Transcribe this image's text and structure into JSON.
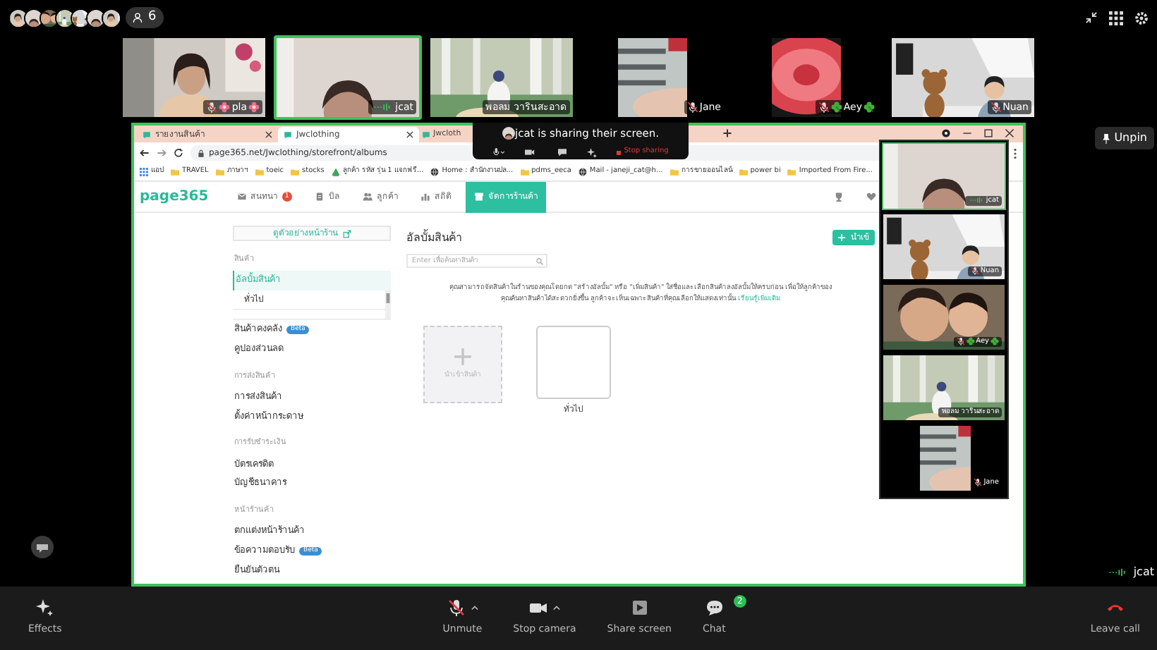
{
  "top_bar": {
    "participant_count": "6"
  },
  "filmstrip": [
    {
      "name": "pla",
      "flowers": true,
      "clovers": false,
      "muted": true,
      "speaking": false,
      "active": false,
      "portrait": false
    },
    {
      "name": "jcat",
      "flowers": false,
      "clovers": false,
      "muted": false,
      "speaking": true,
      "active": true,
      "portrait": false
    },
    {
      "name": "พอลม วารินสะอาด",
      "flowers": false,
      "clovers": false,
      "muted": false,
      "speaking": false,
      "active": false,
      "portrait": false
    },
    {
      "name": "Jane",
      "flowers": false,
      "clovers": false,
      "muted": true,
      "speaking": false,
      "active": false,
      "portrait": true
    },
    {
      "name": "Aey",
      "flowers": false,
      "clovers": true,
      "muted": true,
      "speaking": false,
      "active": false,
      "portrait": true
    },
    {
      "name": "Nuan",
      "flowers": false,
      "clovers": false,
      "muted": true,
      "speaking": false,
      "active": false,
      "portrait": false
    }
  ],
  "browser": {
    "tabs": [
      {
        "label": "รายงานสินค้า",
        "selected": false
      },
      {
        "label": "Jwclothing",
        "selected": true
      },
      {
        "label": "Jwcloth",
        "selected": false
      }
    ],
    "address": "page365.net/Jwclothing/storefront/albums",
    "bookmarks": [
      {
        "label": "แอป",
        "kind": "apps"
      },
      {
        "label": "TRAVEL",
        "kind": "folder"
      },
      {
        "label": "ภาษาฯ",
        "kind": "folder"
      },
      {
        "label": "toeic",
        "kind": "folder"
      },
      {
        "label": "stocks",
        "kind": "folder"
      },
      {
        "label": "ลูกค้า รหัส รุ่น 1 แจกฟรี...",
        "kind": "drive"
      },
      {
        "label": "Home : สำนักงานปล...",
        "kind": "globe"
      },
      {
        "label": "pdms_eeca",
        "kind": "folder"
      },
      {
        "label": "Mail - janeji_cat@h...",
        "kind": "globe"
      },
      {
        "label": "การขายออนไลน์",
        "kind": "folder"
      },
      {
        "label": "power bi",
        "kind": "folder"
      },
      {
        "label": "Imported From Fire...",
        "kind": "folder"
      }
    ]
  },
  "app": {
    "logo": "page365",
    "nav": [
      {
        "label": "สนทนา",
        "kind": "chat",
        "badge": "1",
        "selected": false
      },
      {
        "label": "บิล",
        "kind": "bill",
        "selected": false
      },
      {
        "label": "ลูกค้า",
        "kind": "customers",
        "selected": false
      },
      {
        "label": "สถิติ",
        "kind": "stats",
        "selected": false
      },
      {
        "label": "จัดการร้านค้า",
        "kind": "store",
        "selected": true
      }
    ],
    "preview_button": "ดูตัวอย่างหน้าร้าน",
    "sidebar": [
      {
        "heading": "สินค้า",
        "items": [
          {
            "label": "อัลบั้มสินค้า",
            "selected": true,
            "children": [
              {
                "label": "ทั่วไป"
              }
            ]
          },
          {
            "label": "สินค้าคงคลัง",
            "badge": "Beta",
            "selected": false
          },
          {
            "label": "คูปองส่วนลด",
            "selected": false
          }
        ]
      },
      {
        "heading": "การส่งสินค้า",
        "items": [
          {
            "label": "การส่งสินค้า",
            "selected": false
          },
          {
            "label": "ตั้งค่าหน้ากระดาษ",
            "selected": false
          }
        ]
      },
      {
        "heading": "การรับชำระเงิน",
        "items": [
          {
            "label": "บัตรเครดิต",
            "selected": false
          },
          {
            "label": "บัญชีธนาคาร",
            "selected": false
          }
        ]
      },
      {
        "heading": "หน้าร้านค้า",
        "items": [
          {
            "label": "ตกแต่งหน้าร้านค้า",
            "selected": false
          },
          {
            "label": "ข้อความตอบรับ",
            "badge": "Beta",
            "selected": false
          },
          {
            "label": "ยืนยันตัวตน",
            "selected": false
          }
        ]
      }
    ],
    "title": "อัลบั้มสินค้า",
    "search": {
      "placeholder": "Enter เพื่อค้นหาสินค้า"
    },
    "add_button": "นำเข้",
    "info": "คุณสามารถจัดสินค้าในร้านของคุณโดยกด \"สร้างอัลบั้ม\" หรือ \"เพิ่มสินค้า\" ใส่ชื่อและเลือกสินค้าลงอัลบั้มให้ครบก่อน เพื่อให้ลูกค้าของคุณค้นหาสินค้าได้สะดวกยิ่งขึ้น ลูกค้าจะเห็นเฉพาะสินค้าที่คุณเลือกให้แสดงเท่านั้น",
    "info_link": "เรียนรู้เพิ่มเติม",
    "albums": [
      {
        "kind": "add",
        "label": "นำเข้าสินค้า"
      },
      {
        "kind": "album",
        "label": "ทั่วไป"
      }
    ]
  },
  "share_banner": {
    "message": "jcat is sharing their screen.",
    "stop_label": "Stop sharing"
  },
  "floating_panel": [
    {
      "name": "jcat",
      "flowers": false,
      "clovers": false,
      "muted": false,
      "speaking": true,
      "active": true,
      "portrait": false
    },
    {
      "name": "Nuan",
      "flowers": false,
      "clovers": false,
      "muted": true,
      "speaking": false,
      "active": false,
      "portrait": false
    },
    {
      "name": "Aey",
      "flowers": false,
      "clovers": true,
      "muted": true,
      "speaking": false,
      "active": false,
      "portrait": false
    },
    {
      "name": "พอลม วารินสะอาด",
      "flowers": false,
      "clovers": false,
      "muted": false,
      "speaking": false,
      "active": false,
      "portrait": false
    },
    {
      "name": "Jane",
      "flowers": false,
      "clovers": false,
      "muted": true,
      "speaking": false,
      "active": false,
      "portrait": true
    }
  ],
  "unpin_label": "Unpin",
  "presenter": {
    "name": "jcat",
    "speaking": true
  },
  "toolbar": [
    {
      "kind": "effects",
      "label": "Effects"
    },
    {
      "kind": "mic",
      "label": "Unmute",
      "muted": true,
      "menu": true
    },
    {
      "kind": "camera",
      "label": "Stop camera",
      "menu": true
    },
    {
      "kind": "share",
      "label": "Share screen"
    },
    {
      "kind": "chat",
      "label": "Chat",
      "badge": "2"
    },
    {
      "kind": "leave",
      "label": "Leave call"
    }
  ]
}
